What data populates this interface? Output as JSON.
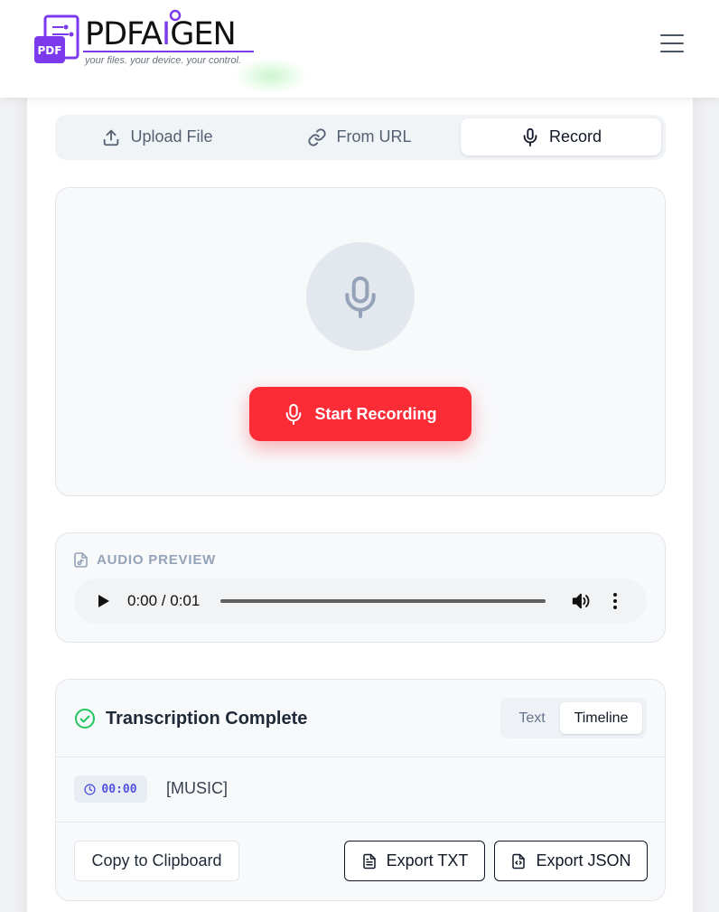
{
  "header": {
    "logo_badge": "PDF",
    "logo_text_a": "PDFA",
    "logo_text_b": "GEN",
    "tagline": "your files. your device. your control.",
    "menu_icon": "hamburger-icon"
  },
  "tabs": [
    {
      "label": "Upload File",
      "icon": "upload-icon",
      "active": false
    },
    {
      "label": "From URL",
      "icon": "link-icon",
      "active": false
    },
    {
      "label": "Record",
      "icon": "microphone-icon",
      "active": true
    }
  ],
  "recorder": {
    "mic_icon": "microphone-icon",
    "start_label": "Start Recording"
  },
  "audio_preview": {
    "label": "AUDIO PREVIEW",
    "time": "0:00 / 0:01",
    "progress": 0
  },
  "transcription": {
    "title": "Transcription Complete",
    "view_options": [
      "Text",
      "Timeline"
    ],
    "active_view": "Timeline",
    "segments": [
      {
        "timestamp": "00:00",
        "text": "[MUSIC]"
      }
    ]
  },
  "actions": {
    "copy_label": "Copy to Clipboard",
    "export_txt_label": "Export TXT",
    "export_json_label": "Export JSON"
  },
  "colors": {
    "brand_purple": "#7c3aed",
    "record_red": "#fb2c36",
    "success_green": "#22c55e",
    "timestamp_blue": "#4f55e0"
  }
}
